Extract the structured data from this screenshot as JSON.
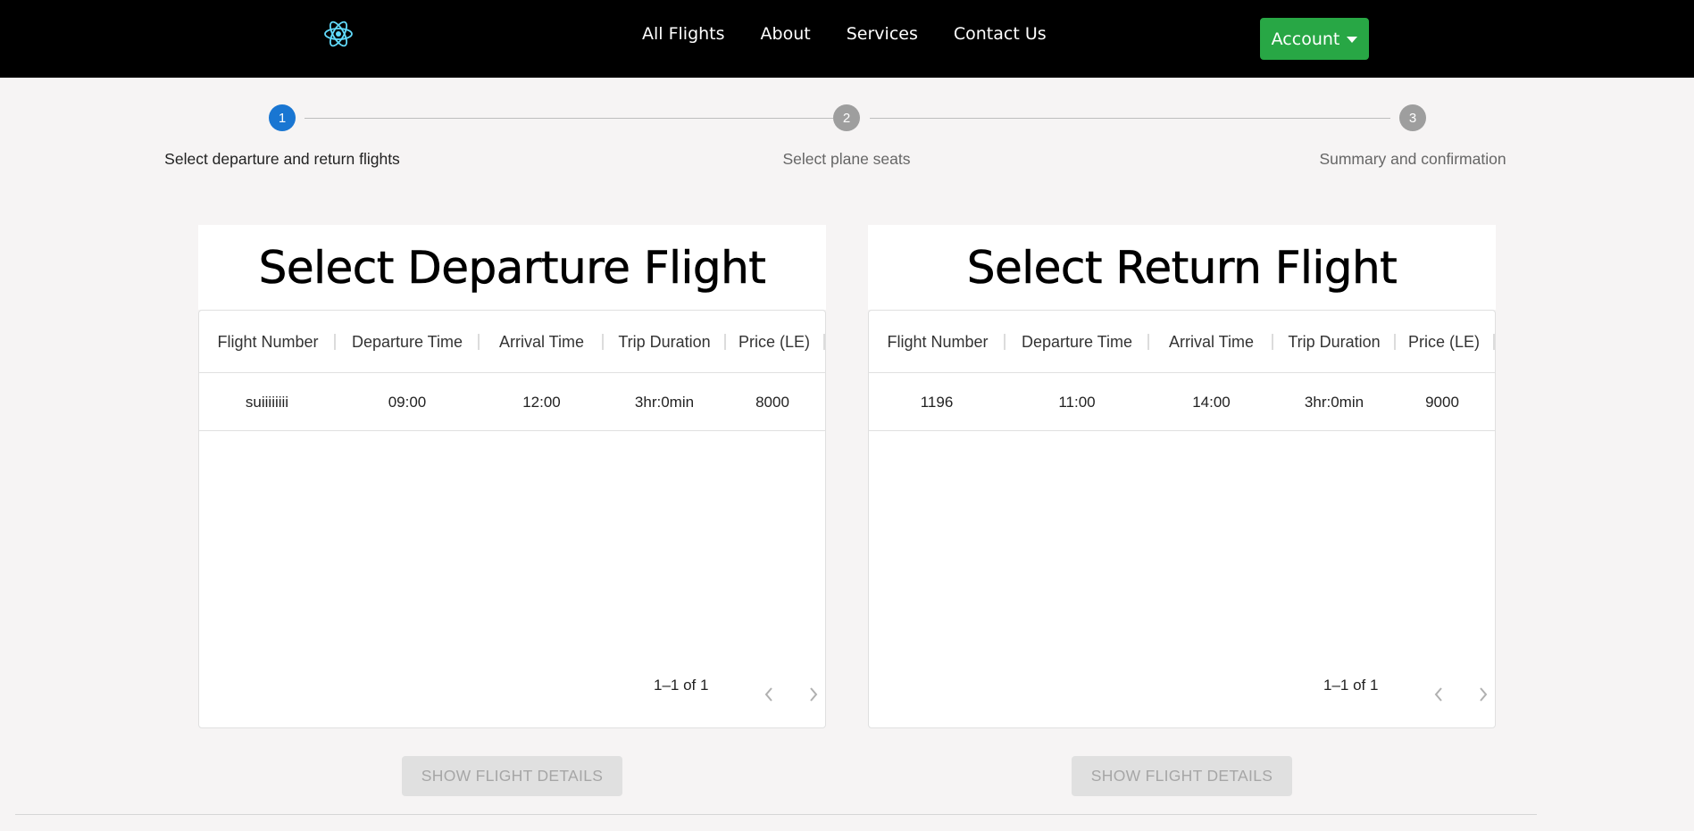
{
  "navbar": {
    "logo_icon": "react-atom-icon",
    "links": [
      "All Flights",
      "About",
      "Services",
      "Contact Us"
    ],
    "account_label": "Account"
  },
  "stepper": {
    "steps": [
      {
        "number": "1",
        "label": "Select departure and return flights",
        "active": true
      },
      {
        "number": "2",
        "label": "Select plane seats",
        "active": false
      },
      {
        "number": "3",
        "label": "Summary and confirmation",
        "active": false
      }
    ],
    "active_color": "#1976d2",
    "inactive_color": "#9e9e9e"
  },
  "departure": {
    "title": "Select Departure Flight",
    "columns": [
      "Flight Number",
      "Departure Time",
      "Arrival Time",
      "Trip Duration",
      "Price (LE)"
    ],
    "rows": [
      {
        "flight_number": "suiiiiiiii",
        "departure_time": "09:00",
        "arrival_time": "12:00",
        "trip_duration": "3hr:0min",
        "price": "8000"
      }
    ],
    "pagination": "1–1 of 1",
    "button_label": "SHOW FLIGHT DETAILS"
  },
  "return": {
    "title": "Select Return Flight",
    "columns": [
      "Flight Number",
      "Departure Time",
      "Arrival Time",
      "Trip Duration",
      "Price (LE)"
    ],
    "rows": [
      {
        "flight_number": "1196",
        "departure_time": "11:00",
        "arrival_time": "14:00",
        "trip_duration": "3hr:0min",
        "price": "9000"
      }
    ],
    "pagination": "1–1 of 1",
    "button_label": "SHOW FLIGHT DETAILS"
  },
  "colors": {
    "navbar_bg": "#000000",
    "account_bg": "#28a745",
    "page_bg": "#f6f4f4"
  }
}
